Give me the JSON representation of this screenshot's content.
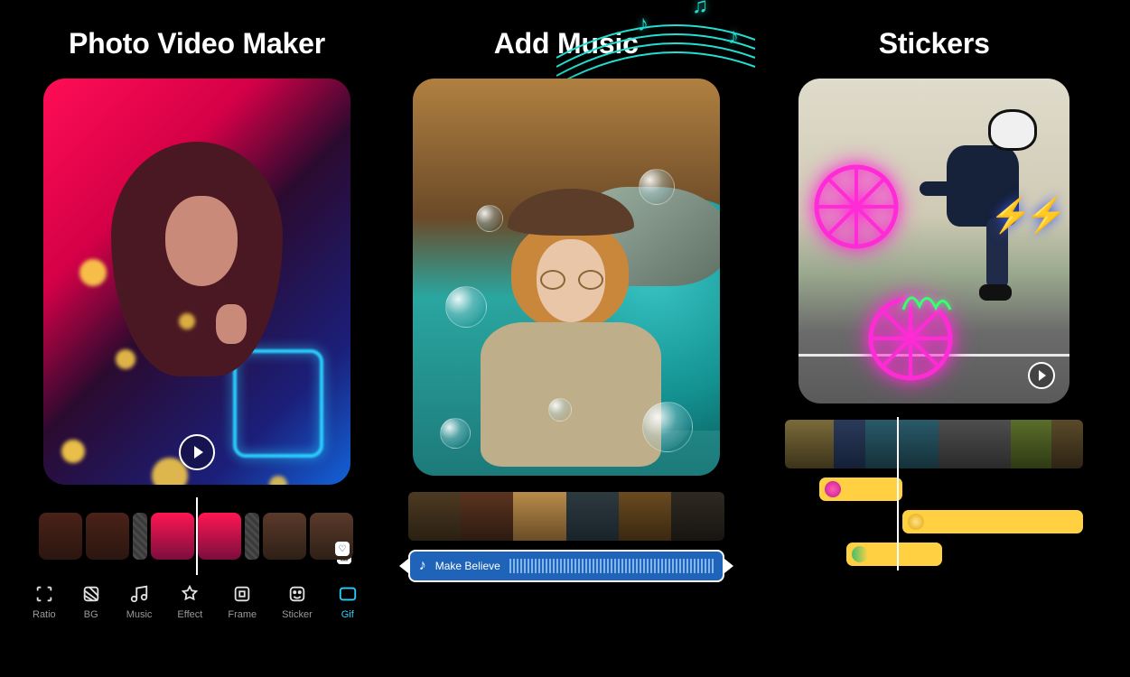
{
  "panels": [
    {
      "title": "Photo Video Maker"
    },
    {
      "title": "Add Music"
    },
    {
      "title": "Stickers"
    }
  ],
  "toolbar": {
    "items": [
      {
        "label": "Ratio",
        "icon": "ratio-icon"
      },
      {
        "label": "BG",
        "icon": "bg-icon"
      },
      {
        "label": "Music",
        "icon": "music-icon"
      },
      {
        "label": "Effect",
        "icon": "effect-icon"
      },
      {
        "label": "Frame",
        "icon": "frame-icon"
      },
      {
        "label": "Sticker",
        "icon": "sticker-icon"
      },
      {
        "label": "Gif",
        "icon": "gif-icon"
      }
    ]
  },
  "music_track": {
    "label": "Make Believe"
  }
}
